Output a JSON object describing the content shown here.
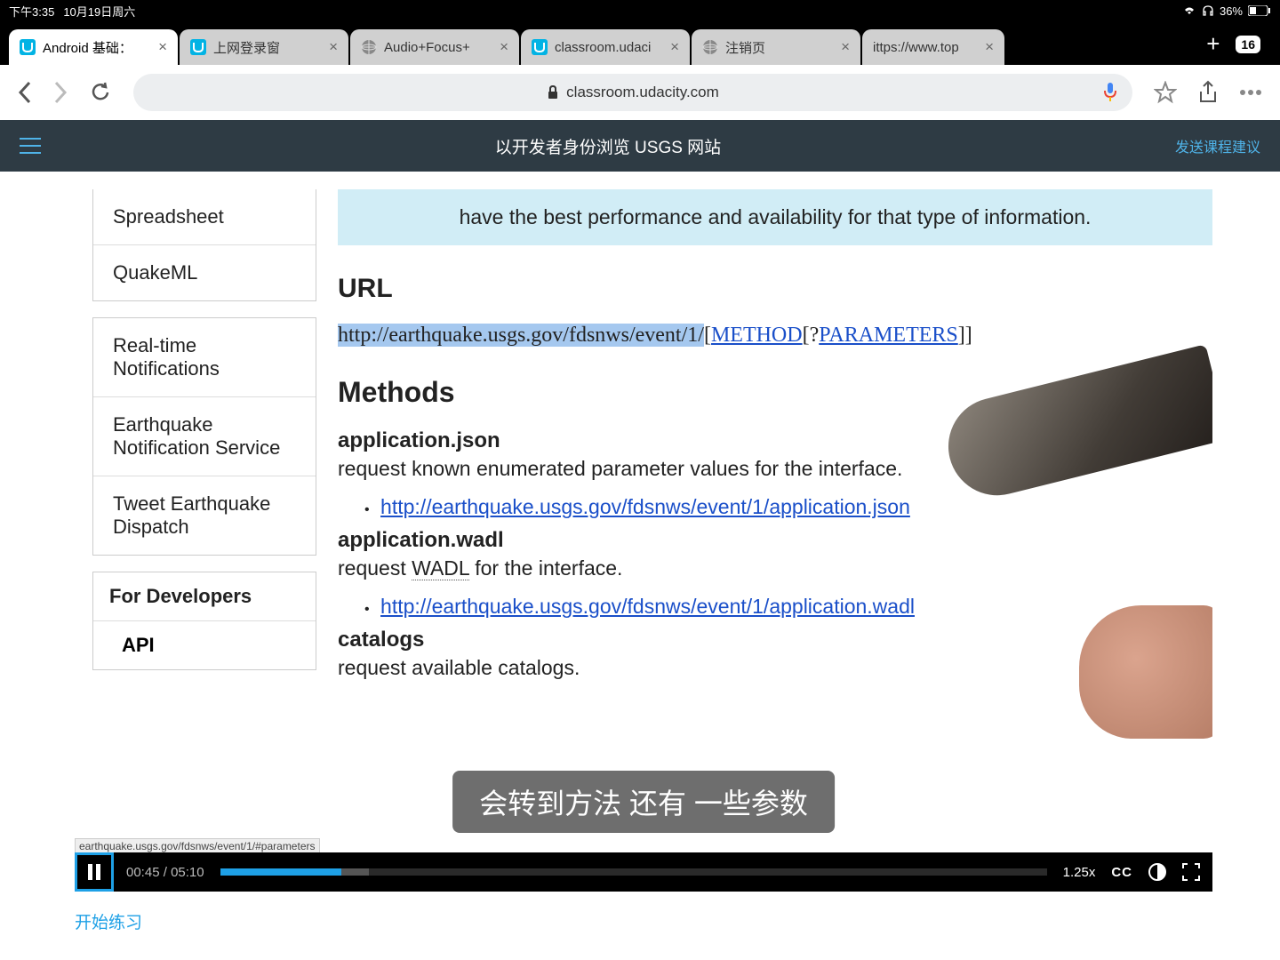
{
  "status": {
    "time": "下午3:35",
    "date": "10月19日周六",
    "battery": "36%"
  },
  "tabs": {
    "items": [
      {
        "title": "Android 基础："
      },
      {
        "title": "上网登录窗"
      },
      {
        "title": "Audio+Focus+"
      },
      {
        "title": "classroom.udaci"
      },
      {
        "title": "注销页"
      },
      {
        "title": "ittps://www.top"
      }
    ],
    "count": "16"
  },
  "url": "classroom.udacity.com",
  "header": {
    "title": "以开发者身份浏览 USGS 网站",
    "feedback": "发送课程建议"
  },
  "sidebar": {
    "g1": [
      "Spreadsheet",
      "QuakeML"
    ],
    "g2": [
      "Real-time Notifications",
      "Earthquake Notification Service",
      "Tweet Earthquake Dispatch"
    ],
    "g3_head": "For Developers",
    "g3_sub": "API"
  },
  "doc": {
    "infobox": "have the best performance and availability for that type of information.",
    "url_heading": "URL",
    "url_base": "http://earthquake.usgs.gov/fdsnws/event/1/",
    "url_method": "METHOD",
    "url_q": "[?",
    "url_params": "PARAMETERS",
    "url_end": "]]",
    "methods_heading": "Methods",
    "m1_title": "application.json",
    "m1_desc": "request known enumerated parameter values for the interface.",
    "m1_link": "http://earthquake.usgs.gov/fdsnws/event/1/application.json",
    "m2_title": "application.wadl",
    "m2_desc_a": "request ",
    "m2_desc_wadl": "WADL",
    "m2_desc_b": " for the interface.",
    "m2_link": "http://earthquake.usgs.gov/fdsnws/event/1/application.wadl",
    "m3_title": "catalogs",
    "m3_desc": "request available catalogs."
  },
  "subtitle": "会转到方法 还有 一些参数",
  "status_url": "earthquake.usgs.gov/fdsnws/event/1/#parameters",
  "player": {
    "cur": "00:45",
    "dur": "05:10",
    "speed": "1.25x",
    "cc": "CC",
    "play_pct": 14.7,
    "buf_pct": 18
  },
  "start_link": "开始练习"
}
